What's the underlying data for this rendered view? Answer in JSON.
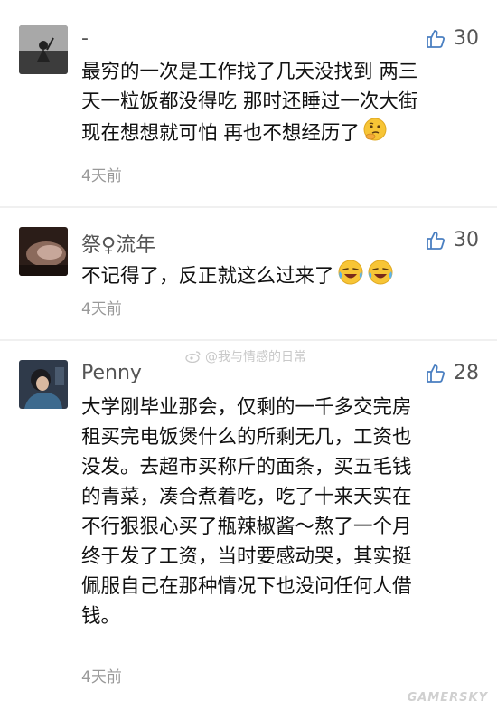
{
  "comments": [
    {
      "username": "-",
      "likes": "30",
      "lines": [
        "最穷的一次是工作找了几天没找到 两三",
        "天一粒饭都没得吃 那时还睡过一次大街",
        "现在想想就可怕 再也不想经历了"
      ],
      "emoji": "thinking-face",
      "time": "4天前"
    },
    {
      "username": "祭♀流年",
      "likes": "30",
      "lines": [
        "不记得了，反正就这么过来了"
      ],
      "emoji": "crying-laughing-face",
      "time": "4天前"
    },
    {
      "username": "Penny",
      "likes": "28",
      "lines": [
        "大学刚毕业那会，仅剩的一千多交完房",
        "租买完电饭煲什么的所剩无几，工资也",
        "没发。去超市买称斤的面条，买五毛钱",
        "的青菜，凑合煮着吃，吃了十来天实在",
        "不行狠狠心买了瓶辣椒酱～熬了一个月",
        "终于发了工资，当时要感动哭，其实挺",
        "佩服自己在那种情况下也没问任何人借",
        "钱。"
      ],
      "time": "4天前"
    }
  ],
  "watermark": "@我与情感的日常",
  "brand": "GAMERSKY"
}
